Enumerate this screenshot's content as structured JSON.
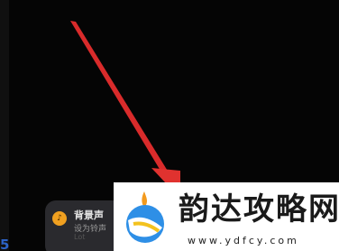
{
  "notification": {
    "title": "背景声",
    "subtitle": "设为铃声",
    "faint_text": "Lot",
    "avatar_icon": "music-icon",
    "accent": "#f0a020"
  },
  "bottom_text": "5",
  "watermark": {
    "title": "韵达攻略网",
    "url": "www.ydfcy.com",
    "logo_icon": "bird-logo-icon"
  },
  "arrow": {
    "color": "#e0322f"
  }
}
